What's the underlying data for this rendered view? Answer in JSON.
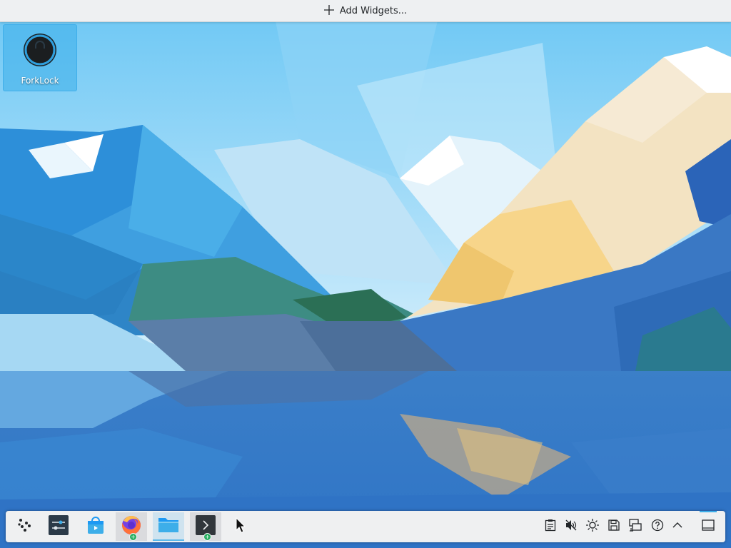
{
  "topbar": {
    "add_widgets_label": "Add Widgets..."
  },
  "desktop": {
    "icons": [
      {
        "label": "ForkLock",
        "icon": "lock-icon"
      }
    ]
  },
  "panel": {
    "launchers": [
      {
        "name": "application-launcher",
        "icon": "kde-launcher-icon"
      },
      {
        "name": "system-settings",
        "icon": "settings-sliders-icon"
      },
      {
        "name": "discover",
        "icon": "discover-store-icon"
      },
      {
        "name": "firefox",
        "icon": "firefox-icon",
        "state": "open"
      },
      {
        "name": "dolphin",
        "icon": "folder-icon",
        "state": "active"
      },
      {
        "name": "konsole",
        "icon": "terminal-icon",
        "state": "open"
      }
    ],
    "tray": [
      {
        "name": "clipboard",
        "icon": "clipboard-icon"
      },
      {
        "name": "volume",
        "icon": "volume-muted-icon"
      },
      {
        "name": "brightness",
        "icon": "brightness-icon"
      },
      {
        "name": "disks",
        "icon": "disk-icon"
      },
      {
        "name": "network",
        "icon": "network-wired-icon"
      },
      {
        "name": "help",
        "icon": "help-icon"
      },
      {
        "name": "expand",
        "icon": "chevron-up-icon"
      }
    ],
    "show_desktop": {
      "icon": "show-desktop-icon"
    }
  },
  "colors": {
    "accent": "#3daee9",
    "panel_bg": "#eff0f1",
    "badge_green": "#27ae60"
  }
}
